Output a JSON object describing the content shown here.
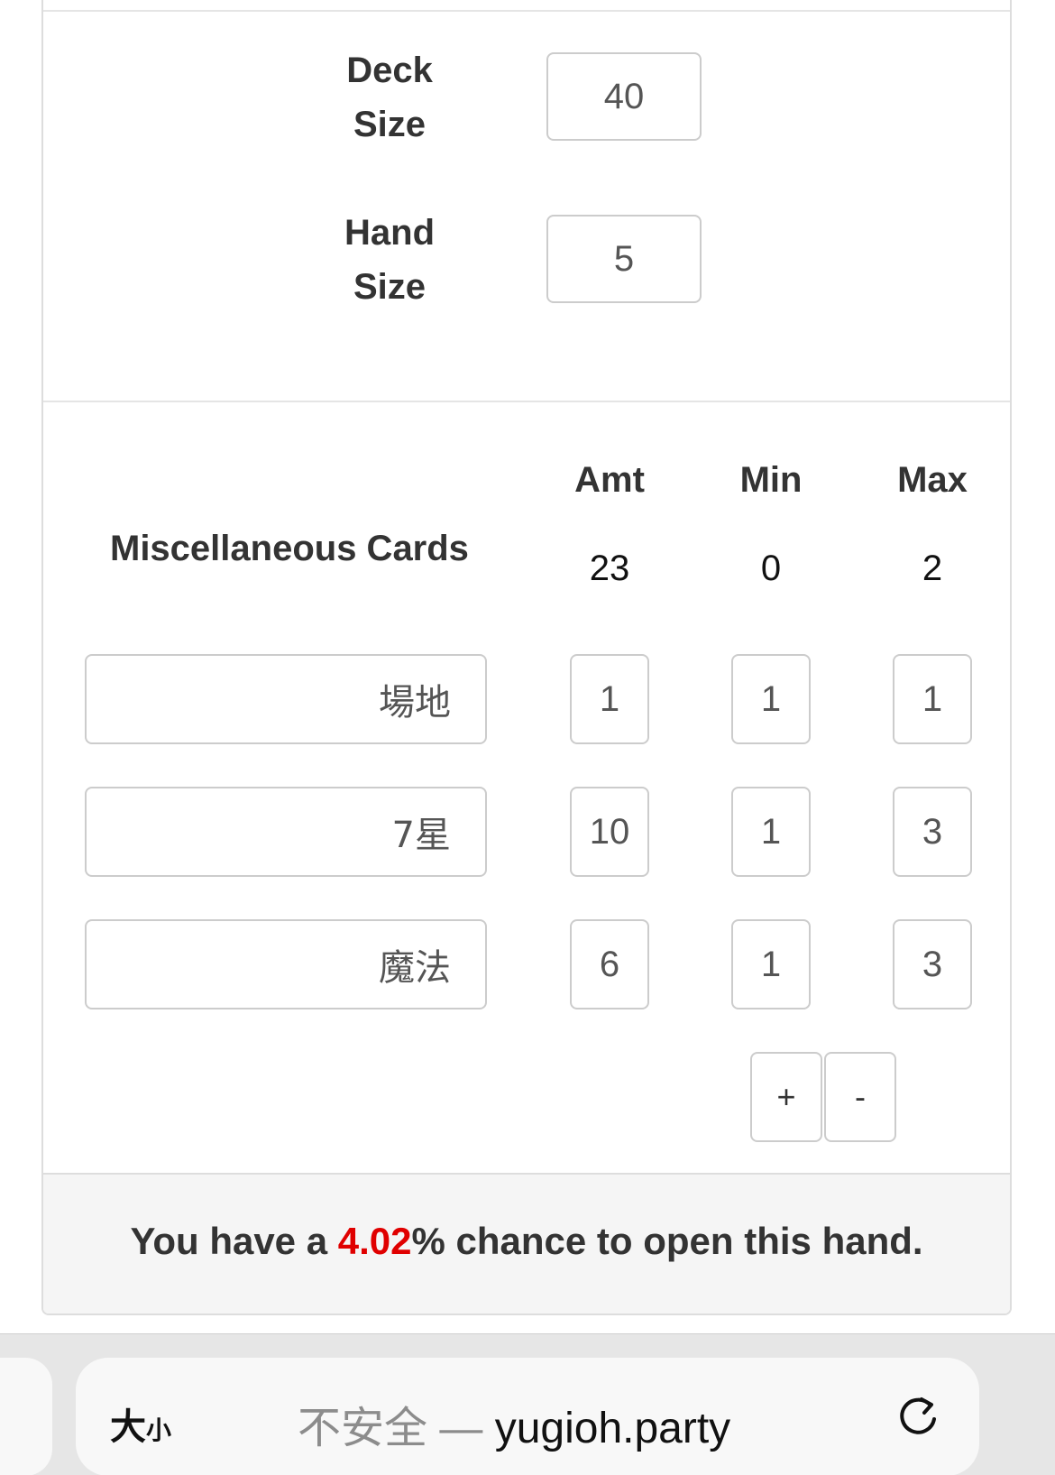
{
  "settings": {
    "deck_size_label_1": "Deck",
    "deck_size_label_2": "Size",
    "deck_size_value": "40",
    "hand_size_label_1": "Hand",
    "hand_size_label_2": "Size",
    "hand_size_value": "5"
  },
  "columns": {
    "amt": "Amt",
    "min": "Min",
    "max": "Max"
  },
  "misc": {
    "label": "Miscellaneous Cards",
    "amt": "23",
    "min": "0",
    "max": "2"
  },
  "cards": [
    {
      "name": "場地",
      "amt": "1",
      "min": "1",
      "max": "1"
    },
    {
      "name": "7星",
      "amt": "10",
      "min": "1",
      "max": "3"
    },
    {
      "name": "魔法",
      "amt": "6",
      "min": "1",
      "max": "3"
    }
  ],
  "buttons": {
    "add": "+",
    "remove": "-"
  },
  "result": {
    "prefix": "You have a ",
    "percent": "4.02",
    "suffix": "% chance to open this hand."
  },
  "browser": {
    "text_size_big": "大",
    "text_size_small": "小",
    "security": "不安全",
    "dash": " — ",
    "host": "yugioh.party",
    "reload_icon": "reload-icon"
  }
}
